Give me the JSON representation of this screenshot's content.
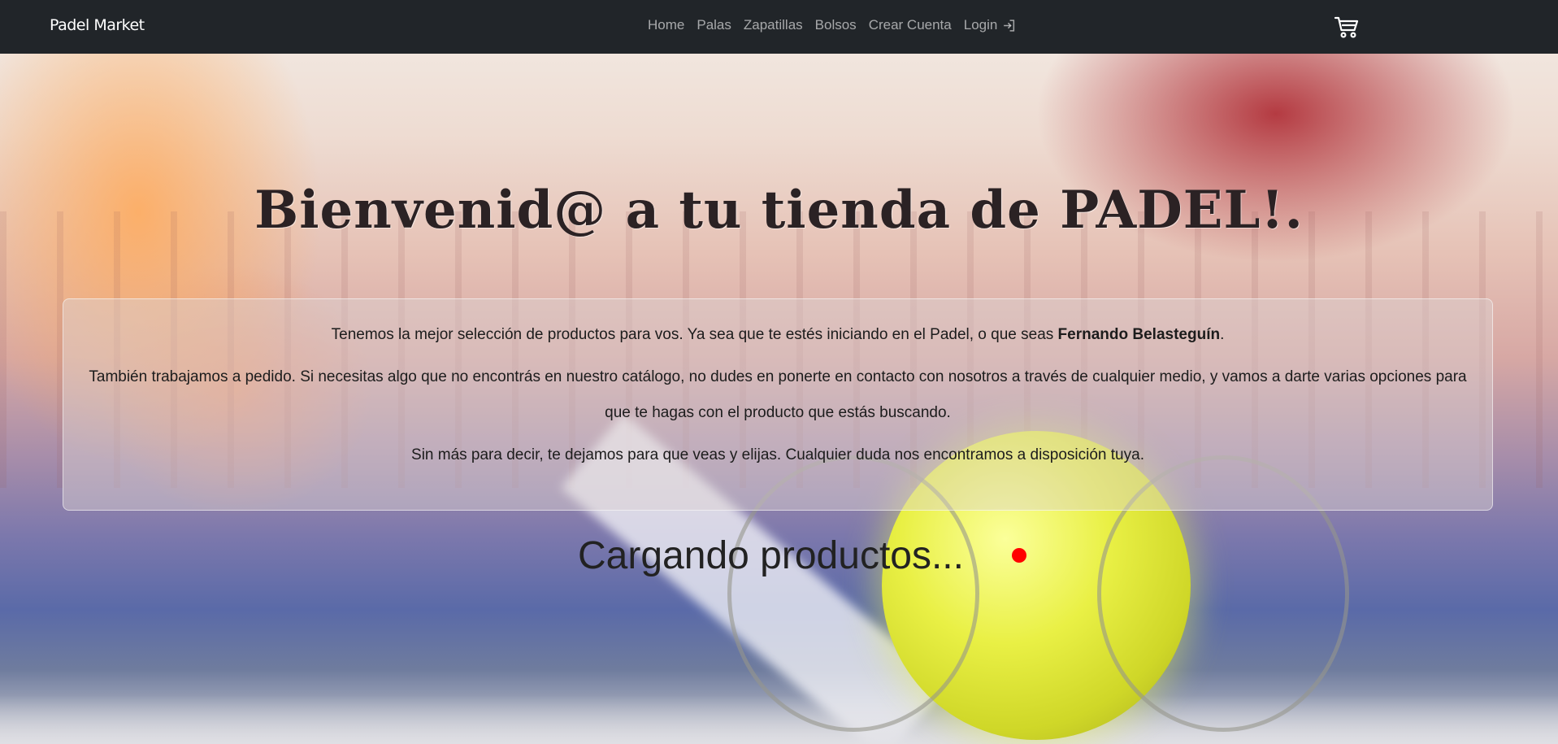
{
  "navbar": {
    "brand": "Padel Market",
    "links": [
      {
        "label": "Home"
      },
      {
        "label": "Palas"
      },
      {
        "label": "Zapatillas"
      },
      {
        "label": "Bolsos"
      },
      {
        "label": "Crear Cuenta"
      },
      {
        "label": "Login",
        "icon": "login-icon"
      }
    ],
    "cart_icon": "cart-icon"
  },
  "hero": {
    "title": "Bienvenid@ a tu tienda de PADEL!."
  },
  "info": {
    "p1_text": "Tenemos la mejor selección de productos para vos. Ya sea que te estés iniciando en el Padel, o que seas ",
    "p1_name": "Fernando Belasteguín",
    "p1_end": ".",
    "p2": "También trabajamos a pedido. Si necesitas algo que no encontrás en nuestro catálogo, no dudes en ponerte en contacto con nosotros a través de cualquier medio, y vamos a darte varias opciones para que te hagas con el producto que estás buscando.",
    "p3": "Sin más para decir, te dejamos para que veas y elijas. Cualquier duda nos encontramos a disposición tuya."
  },
  "status": {
    "loading": "Cargando productos..."
  },
  "colors": {
    "navbar_bg": "#212529",
    "cursor_dot": "#ff0000"
  }
}
